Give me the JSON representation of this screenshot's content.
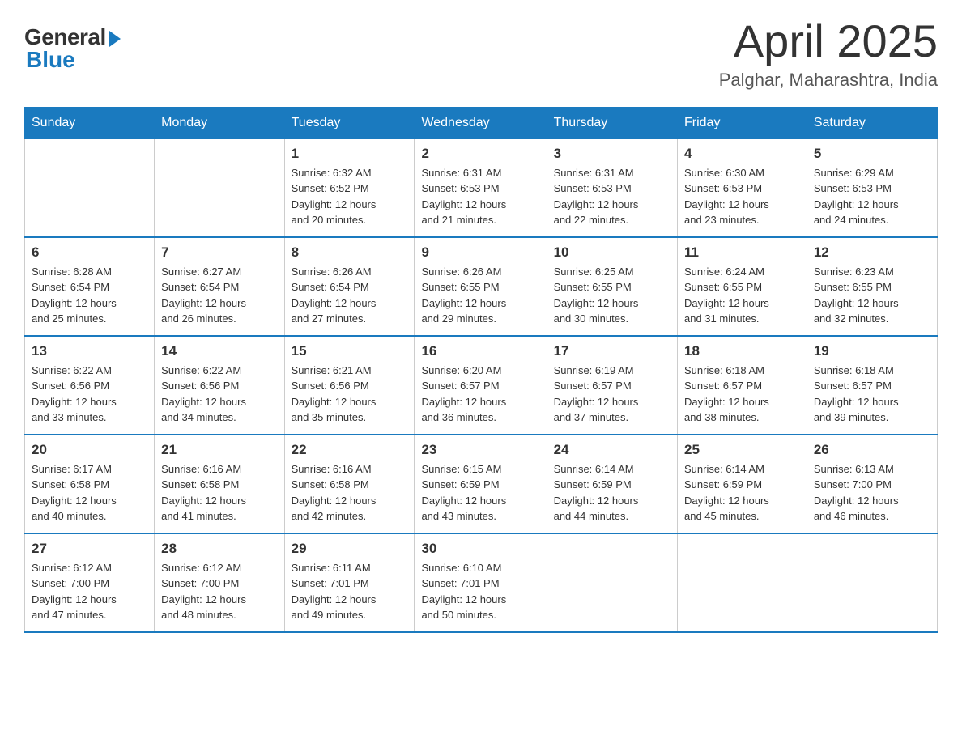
{
  "logo": {
    "general": "General",
    "blue": "Blue"
  },
  "header": {
    "month": "April 2025",
    "location": "Palghar, Maharashtra, India"
  },
  "days_of_week": [
    "Sunday",
    "Monday",
    "Tuesday",
    "Wednesday",
    "Thursday",
    "Friday",
    "Saturday"
  ],
  "weeks": [
    [
      {
        "day": "",
        "info": ""
      },
      {
        "day": "",
        "info": ""
      },
      {
        "day": "1",
        "info": "Sunrise: 6:32 AM\nSunset: 6:52 PM\nDaylight: 12 hours\nand 20 minutes."
      },
      {
        "day": "2",
        "info": "Sunrise: 6:31 AM\nSunset: 6:53 PM\nDaylight: 12 hours\nand 21 minutes."
      },
      {
        "day": "3",
        "info": "Sunrise: 6:31 AM\nSunset: 6:53 PM\nDaylight: 12 hours\nand 22 minutes."
      },
      {
        "day": "4",
        "info": "Sunrise: 6:30 AM\nSunset: 6:53 PM\nDaylight: 12 hours\nand 23 minutes."
      },
      {
        "day": "5",
        "info": "Sunrise: 6:29 AM\nSunset: 6:53 PM\nDaylight: 12 hours\nand 24 minutes."
      }
    ],
    [
      {
        "day": "6",
        "info": "Sunrise: 6:28 AM\nSunset: 6:54 PM\nDaylight: 12 hours\nand 25 minutes."
      },
      {
        "day": "7",
        "info": "Sunrise: 6:27 AM\nSunset: 6:54 PM\nDaylight: 12 hours\nand 26 minutes."
      },
      {
        "day": "8",
        "info": "Sunrise: 6:26 AM\nSunset: 6:54 PM\nDaylight: 12 hours\nand 27 minutes."
      },
      {
        "day": "9",
        "info": "Sunrise: 6:26 AM\nSunset: 6:55 PM\nDaylight: 12 hours\nand 29 minutes."
      },
      {
        "day": "10",
        "info": "Sunrise: 6:25 AM\nSunset: 6:55 PM\nDaylight: 12 hours\nand 30 minutes."
      },
      {
        "day": "11",
        "info": "Sunrise: 6:24 AM\nSunset: 6:55 PM\nDaylight: 12 hours\nand 31 minutes."
      },
      {
        "day": "12",
        "info": "Sunrise: 6:23 AM\nSunset: 6:55 PM\nDaylight: 12 hours\nand 32 minutes."
      }
    ],
    [
      {
        "day": "13",
        "info": "Sunrise: 6:22 AM\nSunset: 6:56 PM\nDaylight: 12 hours\nand 33 minutes."
      },
      {
        "day": "14",
        "info": "Sunrise: 6:22 AM\nSunset: 6:56 PM\nDaylight: 12 hours\nand 34 minutes."
      },
      {
        "day": "15",
        "info": "Sunrise: 6:21 AM\nSunset: 6:56 PM\nDaylight: 12 hours\nand 35 minutes."
      },
      {
        "day": "16",
        "info": "Sunrise: 6:20 AM\nSunset: 6:57 PM\nDaylight: 12 hours\nand 36 minutes."
      },
      {
        "day": "17",
        "info": "Sunrise: 6:19 AM\nSunset: 6:57 PM\nDaylight: 12 hours\nand 37 minutes."
      },
      {
        "day": "18",
        "info": "Sunrise: 6:18 AM\nSunset: 6:57 PM\nDaylight: 12 hours\nand 38 minutes."
      },
      {
        "day": "19",
        "info": "Sunrise: 6:18 AM\nSunset: 6:57 PM\nDaylight: 12 hours\nand 39 minutes."
      }
    ],
    [
      {
        "day": "20",
        "info": "Sunrise: 6:17 AM\nSunset: 6:58 PM\nDaylight: 12 hours\nand 40 minutes."
      },
      {
        "day": "21",
        "info": "Sunrise: 6:16 AM\nSunset: 6:58 PM\nDaylight: 12 hours\nand 41 minutes."
      },
      {
        "day": "22",
        "info": "Sunrise: 6:16 AM\nSunset: 6:58 PM\nDaylight: 12 hours\nand 42 minutes."
      },
      {
        "day": "23",
        "info": "Sunrise: 6:15 AM\nSunset: 6:59 PM\nDaylight: 12 hours\nand 43 minutes."
      },
      {
        "day": "24",
        "info": "Sunrise: 6:14 AM\nSunset: 6:59 PM\nDaylight: 12 hours\nand 44 minutes."
      },
      {
        "day": "25",
        "info": "Sunrise: 6:14 AM\nSunset: 6:59 PM\nDaylight: 12 hours\nand 45 minutes."
      },
      {
        "day": "26",
        "info": "Sunrise: 6:13 AM\nSunset: 7:00 PM\nDaylight: 12 hours\nand 46 minutes."
      }
    ],
    [
      {
        "day": "27",
        "info": "Sunrise: 6:12 AM\nSunset: 7:00 PM\nDaylight: 12 hours\nand 47 minutes."
      },
      {
        "day": "28",
        "info": "Sunrise: 6:12 AM\nSunset: 7:00 PM\nDaylight: 12 hours\nand 48 minutes."
      },
      {
        "day": "29",
        "info": "Sunrise: 6:11 AM\nSunset: 7:01 PM\nDaylight: 12 hours\nand 49 minutes."
      },
      {
        "day": "30",
        "info": "Sunrise: 6:10 AM\nSunset: 7:01 PM\nDaylight: 12 hours\nand 50 minutes."
      },
      {
        "day": "",
        "info": ""
      },
      {
        "day": "",
        "info": ""
      },
      {
        "day": "",
        "info": ""
      }
    ]
  ]
}
